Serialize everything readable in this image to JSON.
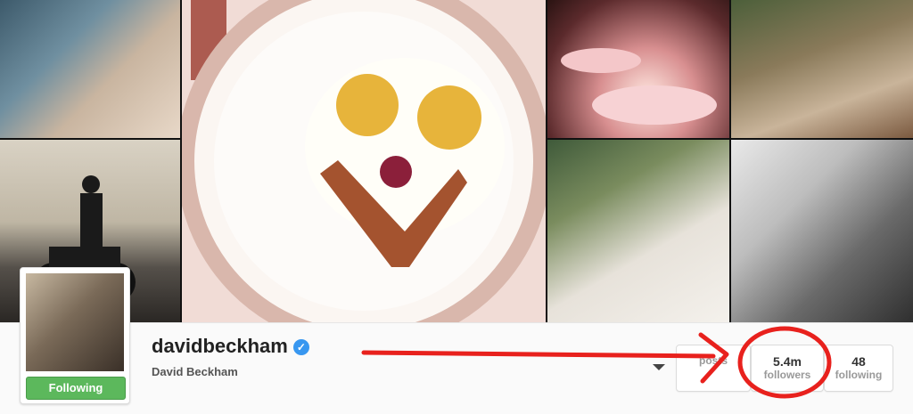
{
  "profile": {
    "username": "davidbeckham",
    "full_name": "David Beckham",
    "follow_label": "Following",
    "verified": true
  },
  "stats": [
    {
      "value": "",
      "label": "posts"
    },
    {
      "value": "5.4m",
      "label": "followers"
    },
    {
      "value": "48",
      "label": "following"
    }
  ],
  "colors": {
    "follow_green": "#5cb85c",
    "verified_blue": "#3897f0",
    "annotation_red": "#e8211d"
  }
}
